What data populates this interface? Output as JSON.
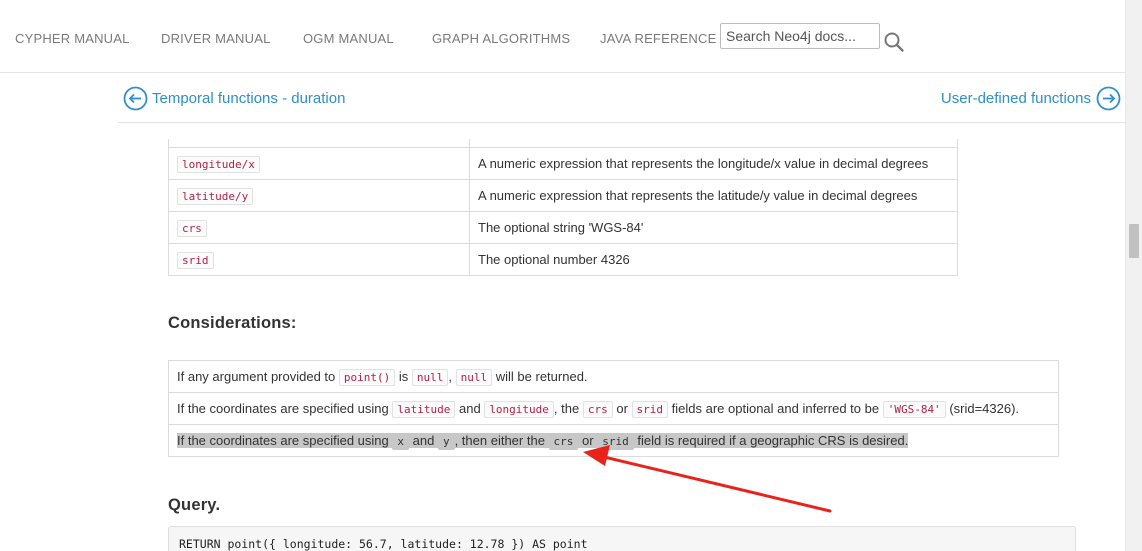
{
  "nav": {
    "items": [
      "CYPHER MANUAL",
      "DRIVER MANUAL",
      "OGM MANUAL",
      "GRAPH ALGORITHMS",
      "JAVA REFERENCE"
    ],
    "search_placeholder": "Search Neo4j docs..."
  },
  "pager": {
    "prev_label": "Temporal functions - duration",
    "next_label": "User-defined functions"
  },
  "params": {
    "rows": [
      {
        "name": "longitude/x",
        "description": "A numeric expression that represents the longitude/x value in decimal degrees"
      },
      {
        "name": "latitude/y",
        "description": "A numeric expression that represents the latitude/y value in decimal degrees"
      },
      {
        "name": "crs",
        "description": "The optional string 'WGS-84'"
      },
      {
        "name": "srid",
        "description": "The optional number 4326"
      }
    ]
  },
  "considerations": {
    "heading": "Considerations:",
    "row1": {
      "t1": "If any argument provided to",
      "c1": "point()",
      "t2": "is",
      "c2": "null",
      "t3": ",",
      "c3": "null",
      "t4": "will be returned."
    },
    "row2": {
      "t1": "If the coordinates are specified using",
      "c1": "latitude",
      "t2": "and",
      "c2": "longitude",
      "t3": ", the",
      "c3": "crs",
      "t4": "or",
      "c4": "srid",
      "t5": "fields are optional and inferred to be",
      "c5": "'WGS-84'",
      "t6": "(srid=4326)."
    },
    "row3": {
      "t1": "If the coordinates are specified using",
      "c1": "x",
      "t2": "and",
      "c2": "y",
      "t3": ", then either the",
      "c3": "crs",
      "t4": "or",
      "c4": "srid",
      "t5": "field is required if a geographic CRS is desired."
    }
  },
  "query": {
    "heading": "Query.",
    "code": "RETURN point({ longitude: 56.7, latitude: 12.78 }) AS point"
  },
  "colors": {
    "link": "#2f8fc8",
    "code_text": "#b12146",
    "arrow": "#e8231c",
    "selection": "#c7c7c7"
  }
}
